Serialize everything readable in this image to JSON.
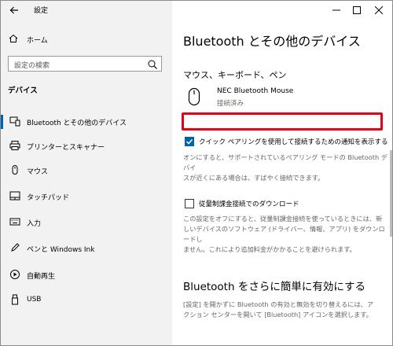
{
  "window": {
    "title": "設定"
  },
  "sidebar": {
    "home_label": "ホーム",
    "search_placeholder": "設定の検索",
    "section_heading": "デバイス",
    "items": [
      {
        "label": "Bluetooth とその他のデバイス",
        "icon": "bluetooth-devices-icon",
        "selected": true
      },
      {
        "label": "プリンターとスキャナー",
        "icon": "printer-icon",
        "selected": false
      },
      {
        "label": "マウス",
        "icon": "mouse-icon",
        "selected": false
      },
      {
        "label": "タッチパッド",
        "icon": "touchpad-icon",
        "selected": false
      },
      {
        "label": "入力",
        "icon": "keyboard-icon",
        "selected": false
      },
      {
        "label": "ペンと Windows Ink",
        "icon": "pen-icon",
        "selected": false
      },
      {
        "label": "自動再生",
        "icon": "autoplay-icon",
        "selected": false
      },
      {
        "label": "USB",
        "icon": "usb-icon",
        "selected": false
      }
    ]
  },
  "main": {
    "title": "Bluetooth とその他のデバイス",
    "section_mouse_keyboard_pen": "マウス、キーボード、ペン",
    "device": {
      "name": "NEC Bluetooth Mouse",
      "status": "接続済み"
    },
    "swift_pair": {
      "checked": true,
      "label": "クイック ペアリングを使用して接続するための通知を表示する",
      "description_line1": "オンにすると、サポートされているペアリング モードの Bluetooth デバイ",
      "description_line2": "スが近くにある場合は、すばやく接続できます。"
    },
    "metered": {
      "checked": false,
      "label": "従量制課金接続でのダウンロード",
      "description_line1": "この設定をオフにすると、従量制課金接続を使っているときには、新",
      "description_line2": "しいデバイスのソフトウェア (ドライバー、情報、アプリ) をダウンロードし",
      "description_line3": "ません。これにより追加料金がかかることを避けられます。"
    },
    "easier_heading": "Bluetooth をさらに簡単に有効にする",
    "easier_description_line1": "[設定] を開かずに Bluetooth の有効と無効を切り替えるには、ア",
    "easier_description_line2": "クション センターを開いて [Bluetooth] アイコンを選択します。"
  },
  "colors": {
    "accent": "#0063b1",
    "highlight": "#e60012"
  }
}
